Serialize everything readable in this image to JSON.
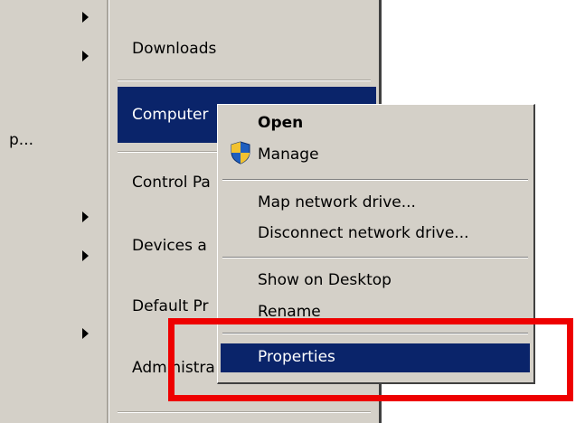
{
  "start_menu": {
    "left_text": "p...",
    "right_items": [
      "Downloads",
      "Computer",
      "Control Pa",
      "Devices a",
      "Default Pr",
      "Administra"
    ]
  },
  "context_menu": {
    "items": [
      "Open",
      "Manage",
      "Map network drive...",
      "Disconnect network drive...",
      "Show on Desktop",
      "Rename",
      "Properties"
    ],
    "highlighted": "Properties"
  },
  "colors": {
    "menu_bg": "#d4d0c8",
    "highlight": "#0a246a",
    "annotation": "#ee0000"
  }
}
